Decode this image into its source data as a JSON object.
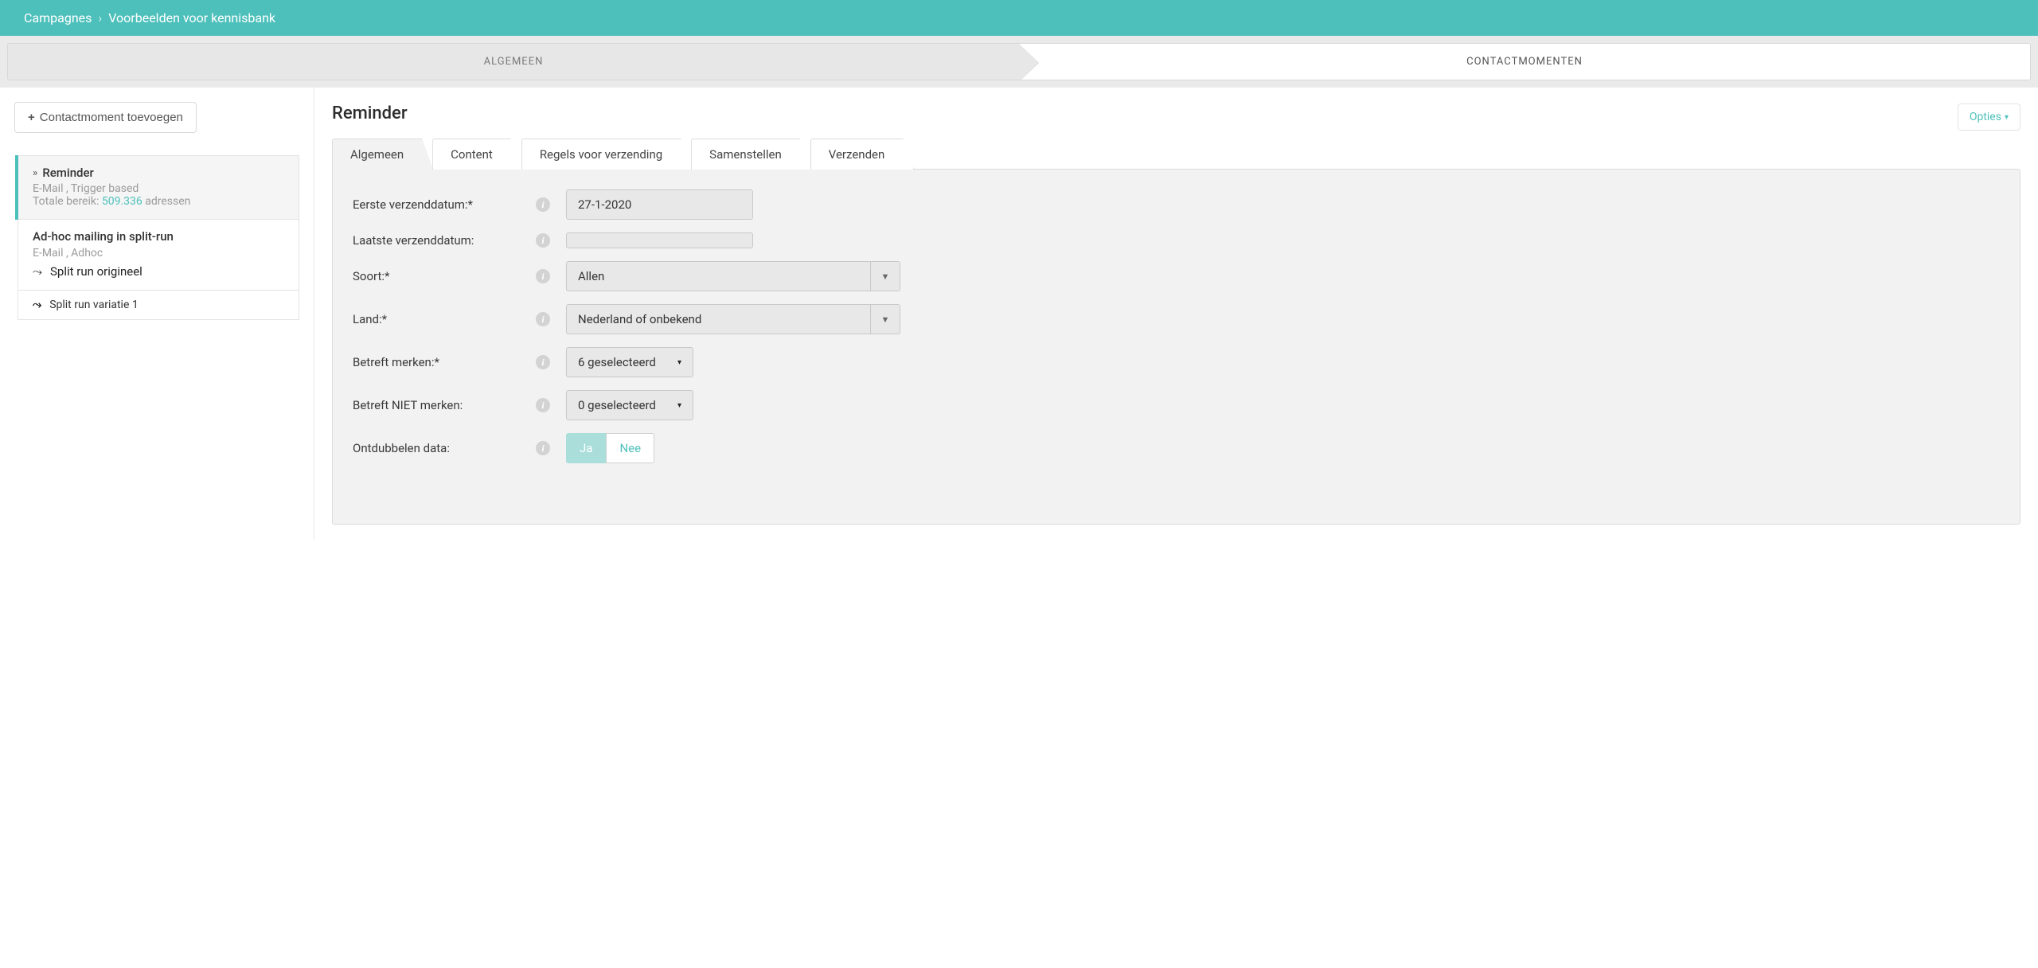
{
  "breadcrumb": {
    "root": "Campagnes",
    "current": "Voorbeelden voor kennisbank"
  },
  "wizard": {
    "step1": "ALGEMEEN",
    "step2": "CONTACTMOMENTEN"
  },
  "sidebar": {
    "add_button": "Contactmoment toevoegen",
    "item1": {
      "title": "Reminder",
      "meta": "E-Mail , Trigger based",
      "reach_label": "Totale bereik: ",
      "reach_number": "509.336",
      "reach_suffix": " adressen"
    },
    "item2": {
      "title": "Ad-hoc mailing in split-run",
      "meta": "E-Mail , Adhoc",
      "split1": "Split run origineel",
      "split2": "Split run variatie 1"
    }
  },
  "main": {
    "heading": "Reminder",
    "options_button": "Opties",
    "tabs": {
      "t1": "Algemeen",
      "t2": "Content",
      "t3": "Regels voor verzending",
      "t4": "Samenstellen",
      "t5": "Verzenden"
    },
    "form": {
      "first_send_label": "Eerste verzenddatum:*",
      "first_send_value": "27-1-2020",
      "last_send_label": "Laatste verzenddatum:",
      "last_send_value": "",
      "soort_label": "Soort:*",
      "soort_value": "Allen",
      "land_label": "Land:*",
      "land_value": "Nederland of onbekend",
      "merken_label": "Betreft merken:*",
      "merken_value": "6 geselecteerd",
      "niet_merken_label": "Betreft NIET merken:",
      "niet_merken_value": "0 geselecteerd",
      "ontdubbel_label": "Ontdubbelen data:",
      "ontdubbel_ja": "Ja",
      "ontdubbel_nee": "Nee"
    }
  }
}
